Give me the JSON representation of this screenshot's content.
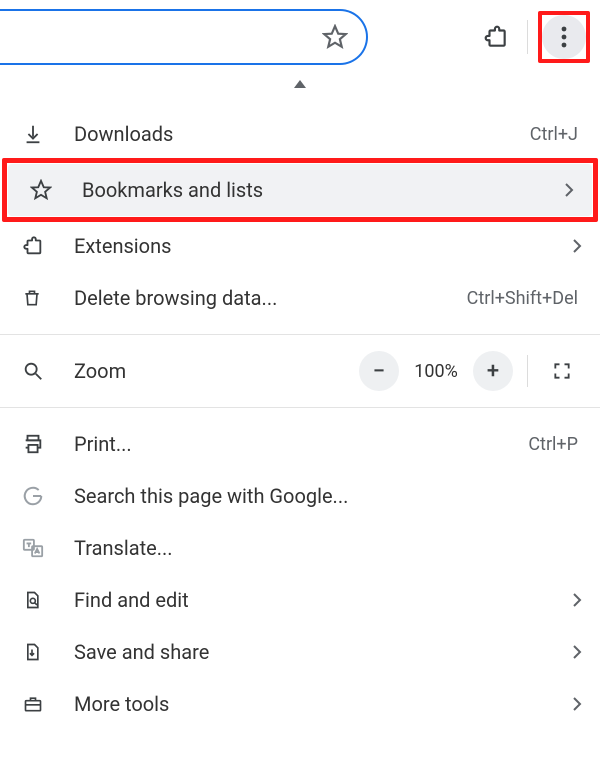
{
  "toolbar": {
    "star_icon": "star",
    "extensions_icon": "puzzle",
    "more_icon": "kebab"
  },
  "menu": {
    "downloads": {
      "label": "Downloads",
      "shortcut": "Ctrl+J"
    },
    "bookmarks": {
      "label": "Bookmarks and lists"
    },
    "extensions": {
      "label": "Extensions"
    },
    "deleteData": {
      "label": "Delete browsing data...",
      "shortcut": "Ctrl+Shift+Del"
    },
    "zoom": {
      "label": "Zoom",
      "level": "100%"
    },
    "print": {
      "label": "Print...",
      "shortcut": "Ctrl+P"
    },
    "searchPage": {
      "label": "Search this page with Google..."
    },
    "translate": {
      "label": "Translate..."
    },
    "findEdit": {
      "label": "Find and edit"
    },
    "saveShare": {
      "label": "Save and share"
    },
    "moreTools": {
      "label": "More tools"
    }
  },
  "annotations": {
    "highlight_color": "#ff1a1a"
  }
}
